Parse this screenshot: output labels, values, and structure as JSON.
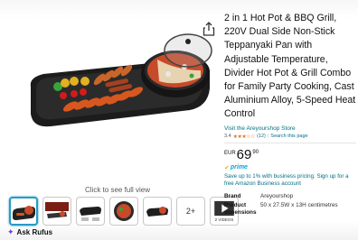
{
  "product": {
    "title": "2 in 1 Hot Pot & BBQ Grill, 220V Dual Side Non-Stick Teppanyaki Pan with Adjustable Temperature, Divider Hot Pot & Grill Combo for Family Party Cooking, Cast Aluminium Alloy, 5-Speed Heat Control",
    "store_link": "Visit the Areyourshop Store",
    "rating_value": "3.4",
    "stars": "★★★☆☆",
    "rating_count": "(12)",
    "search_page_link": "Search this page",
    "price_currency": "EUR",
    "price_whole": "69",
    "price_fraction": "90",
    "prime_label": "prime",
    "business_text": "Save up to 1% with business pricing. Sign up for a free Amazon Business account",
    "specs": [
      {
        "key": "Brand",
        "value": "Areyourshop"
      },
      {
        "key": "Product dimensions",
        "value": "50 x 27.5W x 13H centimetres"
      }
    ]
  },
  "gallery": {
    "click_full_view": "Click to see full view",
    "more_label": "2+",
    "video_label": "2 VIDEOS",
    "ask_rufus": "Ask Rufus"
  },
  "colors": {
    "link": "#007185",
    "star": "#de7921",
    "prime": "#00a8e1",
    "selected_thumb_border": "#2a9ac4"
  },
  "icons": [
    "share-icon",
    "play-icon",
    "rufus-sparkle-icon",
    "prime-check-icon"
  ]
}
